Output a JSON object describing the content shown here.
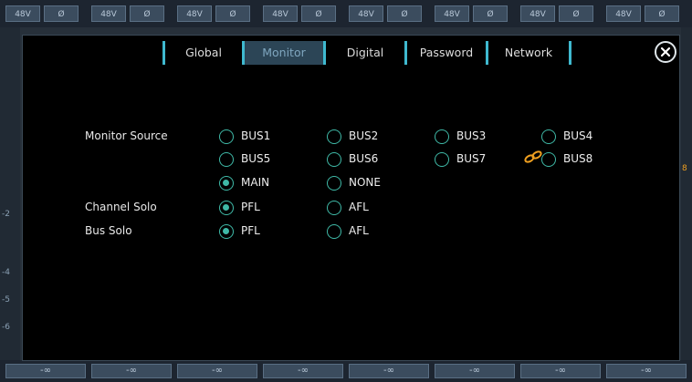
{
  "background": {
    "top_buttons": [
      {
        "a": "48V",
        "b": "Ø"
      },
      {
        "a": "48V",
        "b": "Ø"
      },
      {
        "a": "48V",
        "b": "Ø"
      },
      {
        "a": "48V",
        "b": "Ø"
      },
      {
        "a": "48V",
        "b": "Ø"
      },
      {
        "a": "48V",
        "b": "Ø"
      },
      {
        "a": "48V",
        "b": "Ø"
      },
      {
        "a": "48V",
        "b": "Ø"
      }
    ],
    "bottom_levels": [
      "-∞",
      "-∞",
      "-∞",
      "-∞",
      "-∞",
      "-∞",
      "-∞",
      "-∞"
    ],
    "scale_marks": [
      "-2",
      "-4",
      "-5",
      "-6"
    ],
    "right_badge": "8"
  },
  "tabs": [
    {
      "label": "Global",
      "active": false
    },
    {
      "label": "Monitor",
      "active": true
    },
    {
      "label": "Digital",
      "active": false
    },
    {
      "label": "Password",
      "active": false
    },
    {
      "label": "Network",
      "active": false
    }
  ],
  "monitor_source": {
    "label": "Monitor Source",
    "options": [
      {
        "label": "BUS1",
        "selected": false
      },
      {
        "label": "BUS2",
        "selected": false
      },
      {
        "label": "BUS3",
        "selected": false
      },
      {
        "label": "BUS4",
        "selected": false
      },
      {
        "label": "BUS5",
        "selected": false
      },
      {
        "label": "BUS6",
        "selected": false
      },
      {
        "label": "BUS7",
        "selected": false
      },
      {
        "label": "BUS8",
        "selected": false
      },
      {
        "label": "MAIN",
        "selected": true
      },
      {
        "label": "NONE",
        "selected": false
      }
    ]
  },
  "channel_solo": {
    "label": "Channel Solo",
    "options": [
      {
        "label": "PFL",
        "selected": true
      },
      {
        "label": "AFL",
        "selected": false
      }
    ]
  },
  "bus_solo": {
    "label": "Bus Solo",
    "options": [
      {
        "label": "PFL",
        "selected": true
      },
      {
        "label": "AFL",
        "selected": false
      }
    ]
  },
  "colors": {
    "accent": "#3fb9cf",
    "radio": "#3fb9a7",
    "link": "#f0a020"
  }
}
